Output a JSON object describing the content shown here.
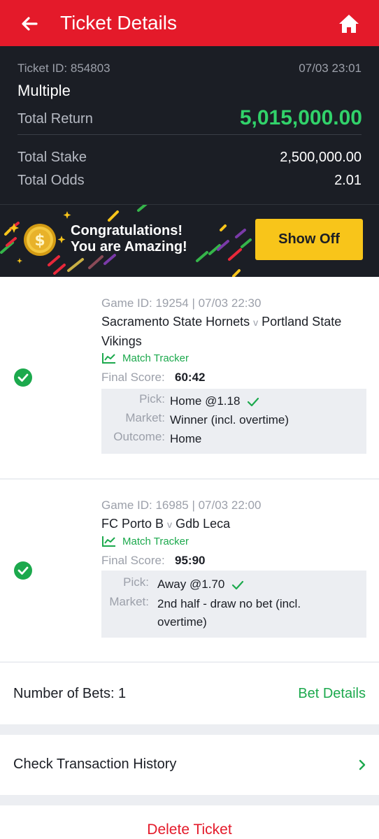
{
  "header": {
    "title": "Ticket Details",
    "back_icon": "arrow-left-icon",
    "home_icon": "home-icon"
  },
  "summary": {
    "ticket_id": "Ticket ID: 854803",
    "ticket_time": "07/03 23:01",
    "ticket_type": "Multiple",
    "total_return_label": "Total Return",
    "total_return_value": "5,015,000.00",
    "total_stake_label": "Total Stake",
    "total_stake_value": "2,500,000.00",
    "total_odds_label": "Total Odds",
    "total_odds_value": "2.01"
  },
  "banner": {
    "line1": "Congratulations!",
    "line2": "You are Amazing!",
    "show_off_label": "Show Off"
  },
  "bets": [
    {
      "game_meta": "Game ID: 19254 | 07/03 22:30",
      "home_team": "Sacramento State Hornets",
      "vs": "v",
      "away_team": "Portland State Vikings",
      "tracker_label": "Match Tracker",
      "final_score_label": "Final Score:",
      "final_score": "60:42",
      "pick_label": "Pick:",
      "pick": "Home @1.18",
      "market_label": "Market:",
      "market": "Winner (incl. overtime)",
      "outcome_label": "Outcome:",
      "outcome": "Home",
      "status": "won"
    },
    {
      "game_meta": "Game ID: 16985 | 07/03 22:00",
      "home_team": "FC Porto B",
      "vs": "v",
      "away_team": "Gdb Leca",
      "tracker_label": "Match Tracker",
      "final_score_label": "Final Score:",
      "final_score": "95:90",
      "pick_label": "Pick:",
      "pick": "Away @1.70",
      "market_label": "Market:",
      "market": "2nd half - draw no bet (incl. overtime)",
      "status": "won"
    }
  ],
  "footer": {
    "number_of_bets": "Number of Bets: 1",
    "bet_details_label": "Bet Details",
    "transaction_history_label": "Check Transaction History",
    "delete_label": "Delete Ticket"
  },
  "colors": {
    "brand_red": "#e41a2a",
    "win_green": "#1ca94d",
    "return_green": "#31d26a",
    "show_off_yellow": "#f8c51a",
    "dark_bg": "#1b1e25"
  }
}
